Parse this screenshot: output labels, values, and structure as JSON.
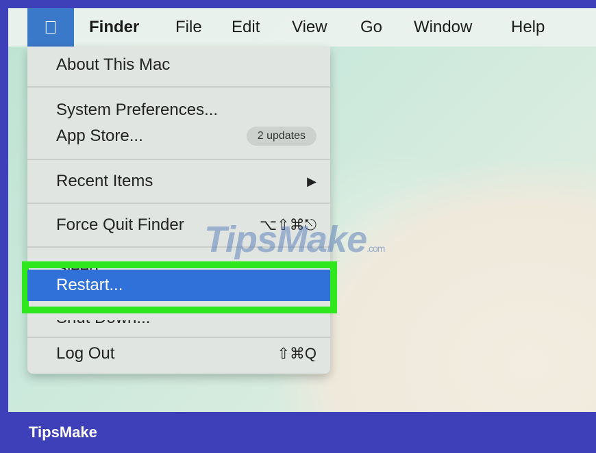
{
  "menubar": {
    "apple_icon": "apple-logo",
    "items": [
      "Finder",
      "File",
      "Edit",
      "View",
      "Go",
      "Window",
      "Help"
    ]
  },
  "apple_menu": {
    "about": "About This Mac",
    "system_prefs": "System Preferences...",
    "app_store": "App Store...",
    "app_store_badge": "2 updates",
    "recent_items": "Recent Items",
    "recent_arrow": "▶",
    "force_quit": "Force Quit Finder",
    "force_quit_shortcut": "⌥⇧⌘⎋",
    "sleep": "Sleep",
    "restart": "Restart...",
    "shut_down": "Shut Down...",
    "log_out": "Log Out",
    "log_out_shortcut": "⇧⌘Q"
  },
  "highlight_color": "#2ee81d",
  "selection_color": "#2f71d8",
  "watermark": {
    "text": "TipsMake",
    "suffix": ".com"
  },
  "footer": {
    "brand": "TipsMake"
  }
}
